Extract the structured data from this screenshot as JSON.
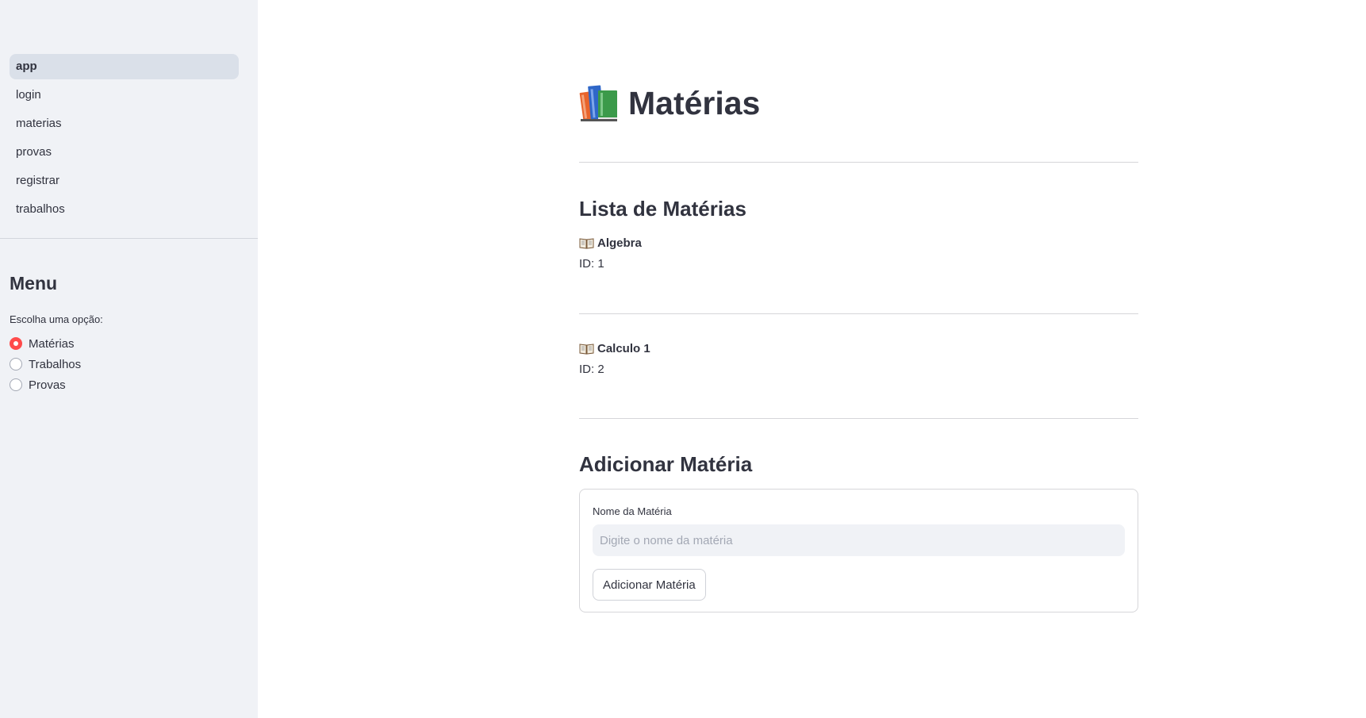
{
  "sidebar": {
    "nav": [
      {
        "label": "app",
        "active": true
      },
      {
        "label": "login"
      },
      {
        "label": "materias"
      },
      {
        "label": "provas"
      },
      {
        "label": "registrar"
      },
      {
        "label": "trabalhos"
      }
    ],
    "menu_title": "Menu",
    "radio_label": "Escolha uma opção:",
    "radio_options": [
      {
        "label": "Matérias",
        "checked": true
      },
      {
        "label": "Trabalhos"
      },
      {
        "label": "Provas"
      }
    ]
  },
  "main": {
    "title_icon": "books-icon",
    "title": "Matérias",
    "list_title": "Lista de Matérias",
    "items": [
      {
        "icon": "open-book-icon",
        "name": "Algebra",
        "id_text": "ID: 1"
      },
      {
        "icon": "open-book-icon",
        "name": "Calculo 1",
        "id_text": "ID: 2"
      }
    ],
    "add_title": "Adicionar Matéria",
    "form": {
      "field_label": "Nome da Matéria",
      "placeholder": "Digite o nome da matéria",
      "value": "",
      "button_label": "Adicionar Matéria"
    }
  },
  "colors": {
    "sidebar_bg": "#f0f2f6",
    "active_nav_bg": "#dae0e9",
    "accent": "#ff4b4b",
    "text": "#31333f"
  }
}
